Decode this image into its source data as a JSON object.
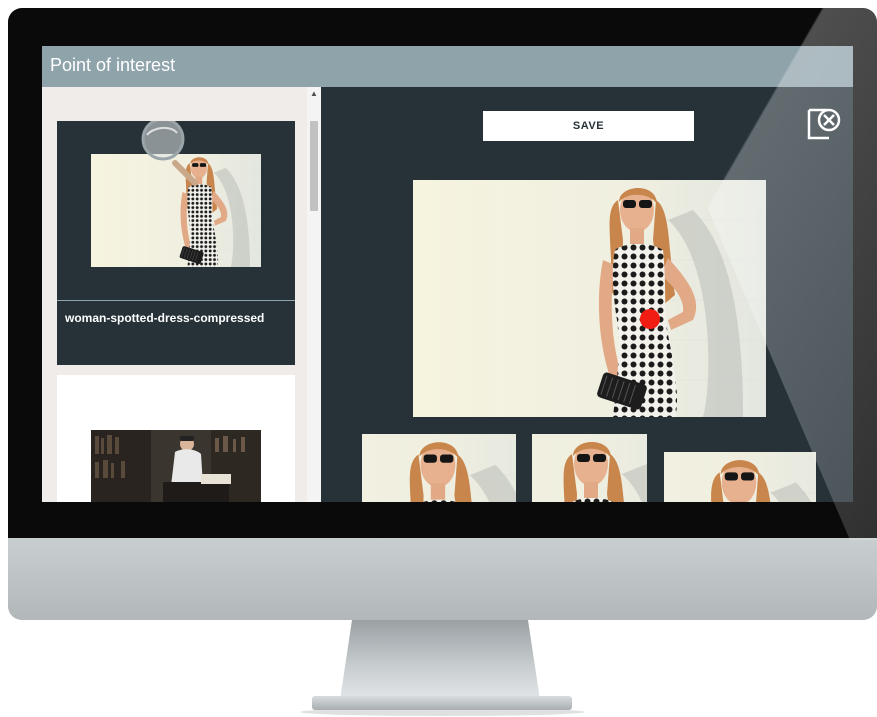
{
  "window": {
    "title": "Point of interest"
  },
  "sidebar": {
    "items": [
      {
        "label": "woman-spotted-dress-compressed",
        "selected": true,
        "thumbnail": "woman-spotted-dress-photo"
      },
      {
        "label": "",
        "selected": false,
        "thumbnail": "man-in-library-photo"
      }
    ],
    "tool_icon": "magnifier-icon"
  },
  "toolbar": {
    "save_label": "SAVE",
    "close_icon": "close-icon"
  },
  "editor": {
    "image": "woman-spotted-dress-photo",
    "poi_marker_color": "#f11d12",
    "previews": [
      "crop-preview-1",
      "crop-preview-2",
      "crop-preview-3"
    ]
  },
  "colors": {
    "title_bar": "#8fa3ab",
    "panel_background": "#263238",
    "sidebar_background": "#f0ecea",
    "accent": "#f11d12"
  }
}
